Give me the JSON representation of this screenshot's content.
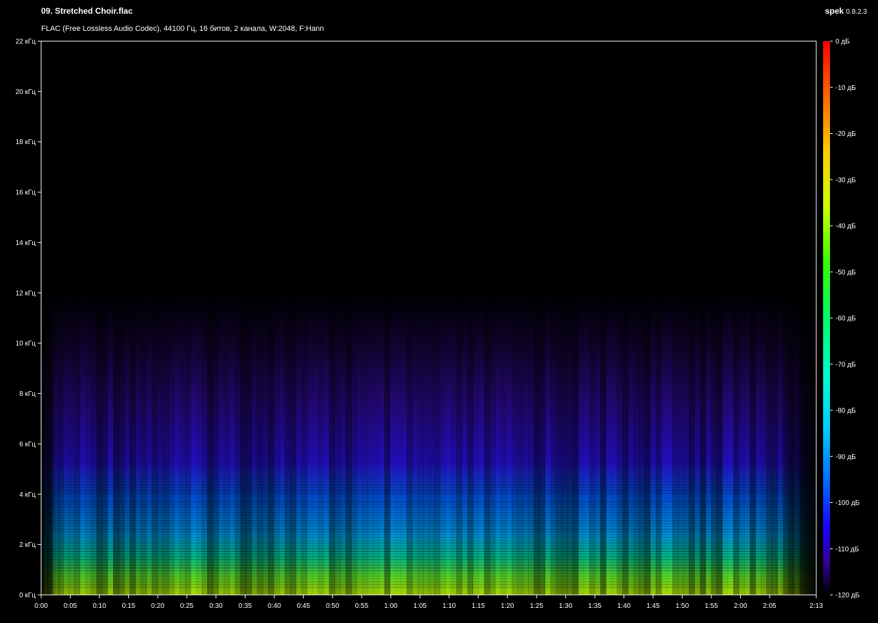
{
  "header": {
    "title": "09. Stretched Choir.flac",
    "info": "FLAC (Free Lossless Audio Codec), 44100 Гц, 16 битов, 2 канала, W:2048, F:Hann",
    "brand": "spek",
    "version": "0.8.2.3"
  },
  "chart_data": {
    "type": "heatmap",
    "title": "09. Stretched Choir.flac",
    "subtitle": "FLAC (Free Lossless Audio Codec), 44100 Гц, 16 битов, 2 канала, W:2048, F:Hann",
    "x_ticks": [
      "0:00",
      "0:05",
      "0:10",
      "0:15",
      "0:20",
      "0:25",
      "0:30",
      "0:35",
      "0:40",
      "0:45",
      "0:50",
      "0:55",
      "1:00",
      "1:05",
      "1:10",
      "1:15",
      "1:20",
      "1:25",
      "1:30",
      "1:35",
      "1:40",
      "1:45",
      "1:50",
      "1:55",
      "2:00",
      "2:05",
      "2:13"
    ],
    "x_tick_seconds": [
      0,
      5,
      10,
      15,
      20,
      25,
      30,
      35,
      40,
      45,
      50,
      55,
      60,
      65,
      70,
      75,
      80,
      85,
      90,
      95,
      100,
      105,
      110,
      115,
      120,
      125,
      133
    ],
    "xlim_seconds": [
      0,
      133
    ],
    "y_ticks": [
      "0 кГц",
      "2 кГц",
      "4 кГц",
      "6 кГц",
      "8 кГц",
      "10 кГц",
      "12 кГц",
      "14 кГц",
      "16 кГц",
      "18 кГц",
      "20 кГц",
      "22 кГц"
    ],
    "y_tick_khz": [
      0,
      2,
      4,
      6,
      8,
      10,
      12,
      14,
      16,
      18,
      20,
      22
    ],
    "ylim_khz": [
      0,
      22
    ],
    "colorbar_ticks": [
      "0 дБ",
      "-10 дБ",
      "-20 дБ",
      "-30 дБ",
      "-40 дБ",
      "-50 дБ",
      "-60 дБ",
      "-70 дБ",
      "-80 дБ",
      "-90 дБ",
      "-100 дБ",
      "-110 дБ",
      "-120 дБ"
    ],
    "colorbar_db": [
      0,
      -10,
      -20,
      -30,
      -40,
      -50,
      -60,
      -70,
      -80,
      -90,
      -100,
      -110,
      -120
    ],
    "colorbar_range_db": [
      0,
      -120
    ],
    "colormap": [
      "#ff0000",
      "#ff6600",
      "#ffcc00",
      "#ccff00",
      "#33ff00",
      "#00ff66",
      "#00ffcc",
      "#00ccff",
      "#0066ff",
      "#0000ff",
      "#3300cc",
      "#220055",
      "#000000"
    ],
    "energy_bands_khz": {
      "strong_green_yellow": [
        0,
        1.2
      ],
      "cyan_blue": [
        1.2,
        4
      ],
      "purple_fade_top": [
        4,
        10.5
      ]
    },
    "signal_span_seconds": [
      0,
      133
    ]
  }
}
